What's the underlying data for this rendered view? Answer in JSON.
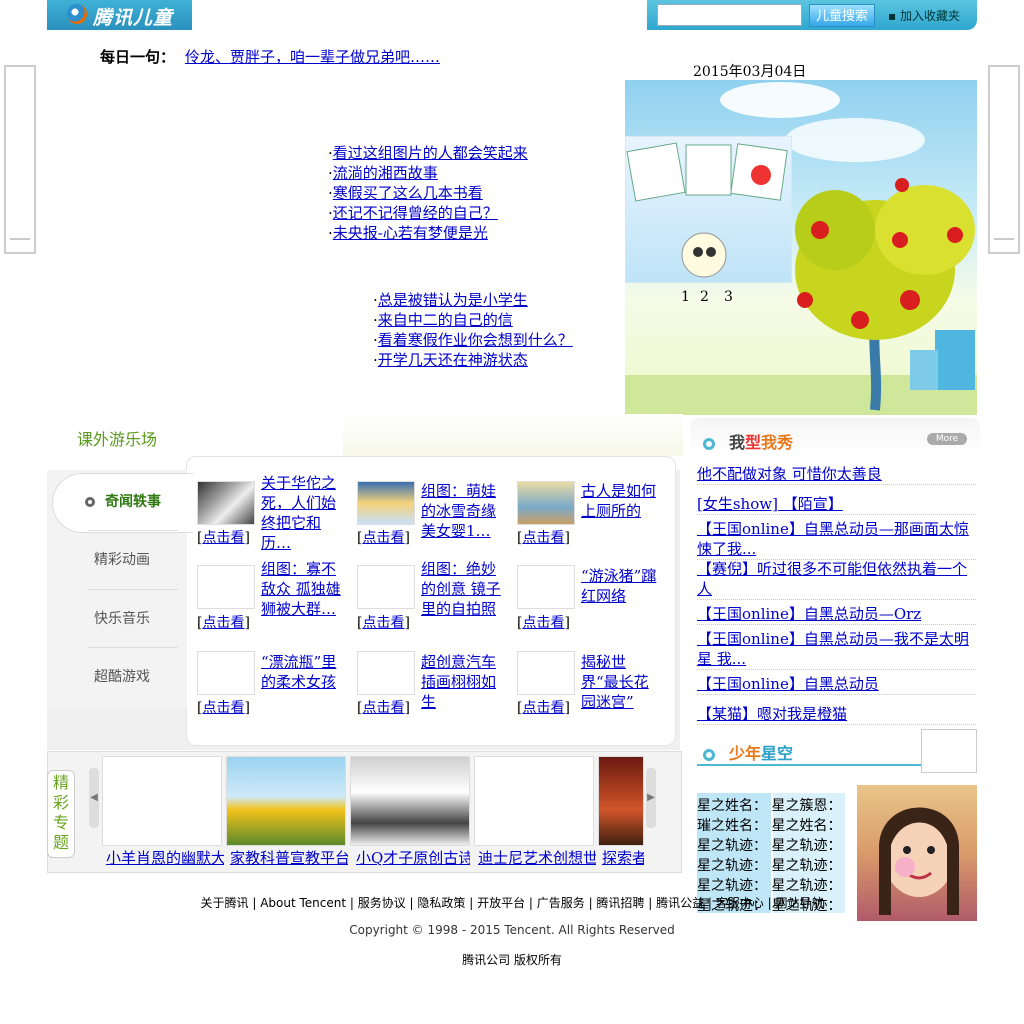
{
  "header": {
    "logo_text": "腾讯儿童",
    "search_button": "儿童搜索",
    "favorite": "▪ 加入收藏夹"
  },
  "daily": {
    "label": "每日一句：",
    "text": "伶龙、贾胖子，咱一辈子做兄弟吧……"
  },
  "date": "2015年03月04日",
  "news_group1": [
    "看过这组图片的人都会笑起来",
    "流淌的湘西故事",
    "寒假买了这么几本书看",
    "还记不记得曾经的自己？",
    "未央报-心若有梦便是光"
  ],
  "news_group2": [
    "总是被错认为是小学生",
    "来自中二的自己的信",
    "看着寒假作业你会想到什么？",
    "开学几天还在神游状态"
  ],
  "slider": {
    "pages": [
      "1",
      "2",
      "3"
    ]
  },
  "playground": {
    "title": "课外游乐场",
    "tabs": [
      "奇闻轶事",
      "精彩动画",
      "快乐音乐",
      "超酷游戏"
    ],
    "view_label": "点击看",
    "items": [
      "关于华佗之死，人们始终把它和历…",
      "组图：萌娃的冰雪奇缘美女婴1…",
      "古人是如何上厕所的",
      "组图：寡不敌众 孤独雄狮被大群…",
      "组图：绝妙的创意 镜子里的自拍照",
      "“游泳猪”蹿红网络",
      "“漂流瓶”里的柔术女孩",
      "超创意汽车插画栩栩如生",
      "揭秘世界“最长花园迷宫”"
    ]
  },
  "specials": {
    "label": "精彩专题",
    "items": [
      "小羊肖恩的幽默大侵…",
      "家教科普宣教平台…",
      "小Q才子原创古诗…",
      "迪士尼艺术创想世界…",
      "探索者…"
    ]
  },
  "show": {
    "title_a": "我",
    "title_b": "型",
    "title_c": "我秀",
    "more": "More",
    "items": [
      "他不配做对象 可惜你太善良",
      "[女生show] 【陌宣】",
      "【王国online】自黑总动员—那画面太惊悚了我...",
      "【赛倪】听过很多不可能但依然执着一个人",
      "【王国online】自黑总动员—Orz",
      "【王国online】自黑总动员—我不是太明星 我...",
      "【王国online】自黑总动员",
      "【某猫】嗯对我是橙猫"
    ]
  },
  "stars": {
    "title_a": "少年",
    "title_b": "星空",
    "rows": [
      [
        "星之姓名：",
        "星之簇恩："
      ],
      [
        "璀之姓名：",
        "星之姓名："
      ],
      [
        "星之轨迹：",
        "星之轨迹："
      ],
      [
        "星之轨迹：",
        "星之轨迹："
      ],
      [
        "星之轨迹：",
        "星之轨迹："
      ],
      [
        "星之轨迹：",
        "星之轨迹："
      ]
    ]
  },
  "footer": {
    "links": "关于腾讯 | About Tencent | 服务协议 | 隐私政策 | 开放平台 | 广告服务 | 腾讯招聘 | 腾讯公益 | 客服中心 | 网站导航",
    "copyright": "Copyright © 1998 - 2015 Tencent. All Rights Reserved",
    "rights": "腾讯公司 版权所有"
  }
}
